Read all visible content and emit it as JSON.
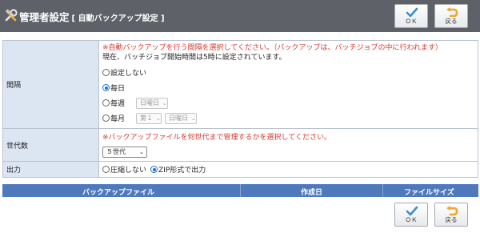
{
  "header": {
    "title": "管理者設定",
    "subtitle": "[ 自動バックアップ設定 ]",
    "ok_label": "ＯＫ",
    "back_label": "戻る"
  },
  "form": {
    "interval": {
      "label": "間隔",
      "note": "※自動バックアップを行う間隔を選択してください。（バックアップは、バッチジョブの中に行われます）",
      "info": "現在、バッチジョブ開始時間は5時に設定されています。",
      "options": {
        "none": "設定しない",
        "daily": "毎日",
        "weekly": "毎週",
        "monthly": "毎月"
      },
      "selected": "daily",
      "weekly_day": "日曜日",
      "monthly_week": "第１",
      "monthly_day": "日曜日"
    },
    "generations": {
      "label": "世代数",
      "note": "※バックアップファイルを何世代まで管理するかを選択してください。",
      "value": "５世代"
    },
    "output": {
      "label": "出力",
      "option_nocompress": "圧縮しない",
      "option_zip": "ZIP形式で出力",
      "selected": "zip"
    }
  },
  "file_list": {
    "columns": [
      "バックアップファイル",
      "作成日",
      "ファイルサイズ"
    ]
  },
  "footer": {
    "ok_label": "ＯＫ",
    "back_label": "戻る"
  },
  "colors": {
    "header_bg": "#5e6268",
    "label_bg": "#dce6f3",
    "table_head_bg": "#4f79bd",
    "note_red": "#d9372e",
    "ok_check": "#3a8fd0",
    "back_arrow": "#f0a531"
  }
}
